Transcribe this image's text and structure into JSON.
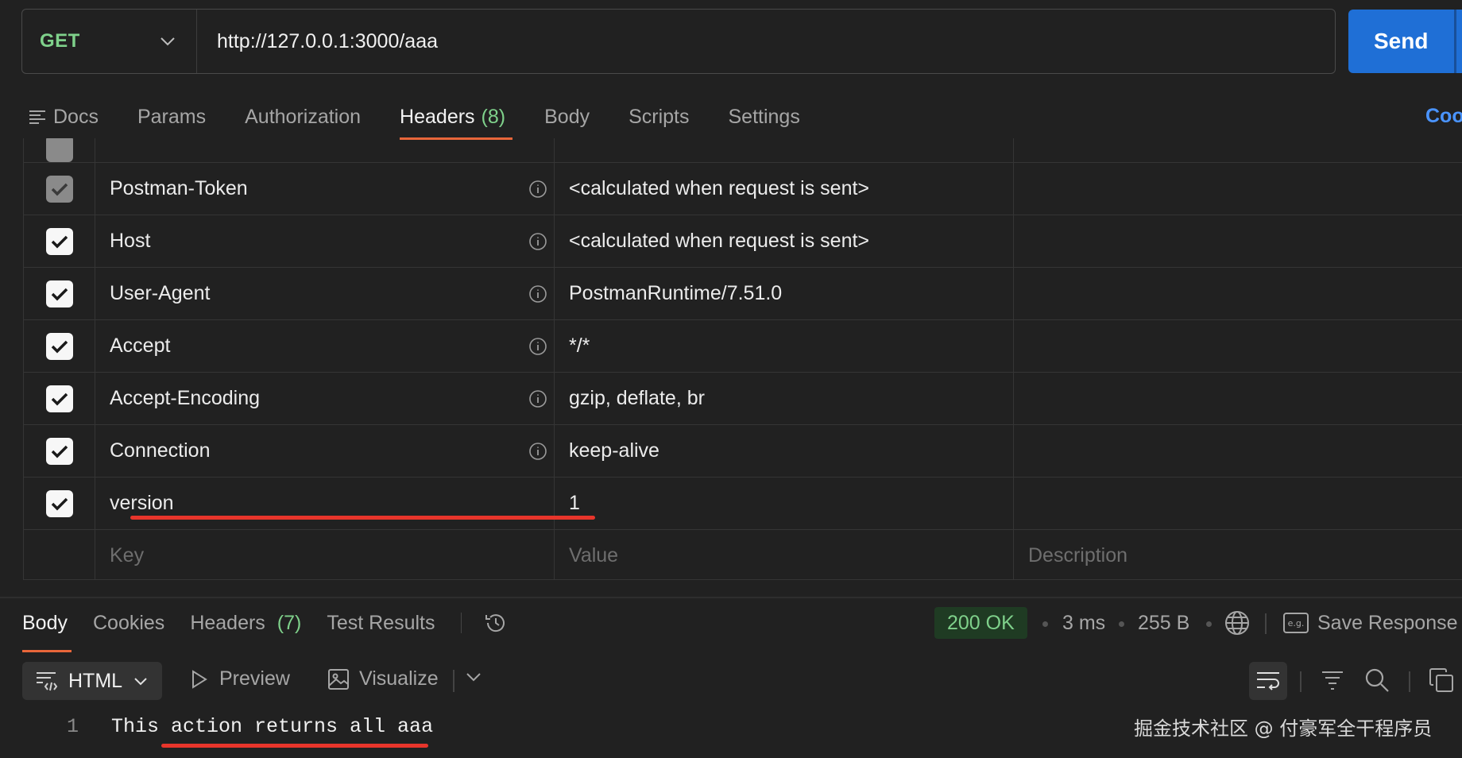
{
  "request": {
    "method": "GET",
    "url": "http://127.0.0.1:3000/aaa",
    "send_label": "Send"
  },
  "request_tabs": {
    "docs": "Docs",
    "params": "Params",
    "authorization": "Authorization",
    "headers": "Headers",
    "headers_count": "(8)",
    "body": "Body",
    "scripts": "Scripts",
    "settings": "Settings",
    "cookies": "Coo"
  },
  "headers_table": {
    "rows": [
      {
        "key": "Postman-Token",
        "value": "<calculated when request is sent>",
        "checked": true,
        "auto": true
      },
      {
        "key": "Host",
        "value": "<calculated when request is sent>",
        "checked": true,
        "auto": false
      },
      {
        "key": "User-Agent",
        "value": "PostmanRuntime/7.51.0",
        "checked": true,
        "auto": false
      },
      {
        "key": "Accept",
        "value": "*/*",
        "checked": true,
        "auto": false
      },
      {
        "key": "Accept-Encoding",
        "value": "gzip, deflate, br",
        "checked": true,
        "auto": false
      },
      {
        "key": "Connection",
        "value": "keep-alive",
        "checked": true,
        "auto": false
      },
      {
        "key": "version",
        "value": "1",
        "checked": true,
        "auto": false
      }
    ],
    "placeholder_key": "Key",
    "placeholder_value": "Value",
    "placeholder_description": "Description"
  },
  "response": {
    "tabs": {
      "body": "Body",
      "cookies": "Cookies",
      "headers": "Headers",
      "headers_count": "(7)",
      "test_results": "Test Results"
    },
    "status": "200 OK",
    "time": "3 ms",
    "size": "255 B",
    "save_response": "Save Response",
    "format": "HTML",
    "preview": "Preview",
    "visualize": "Visualize",
    "line_number": "1",
    "body_text": "This action returns all aaa"
  },
  "watermark": "掘金技术社区 @ 付豪军全干程序员",
  "colors": {
    "accent_orange": "#e8663a",
    "method_green": "#7fd18b",
    "send_blue": "#1f6fd6",
    "annotation_red": "#e8352b"
  }
}
